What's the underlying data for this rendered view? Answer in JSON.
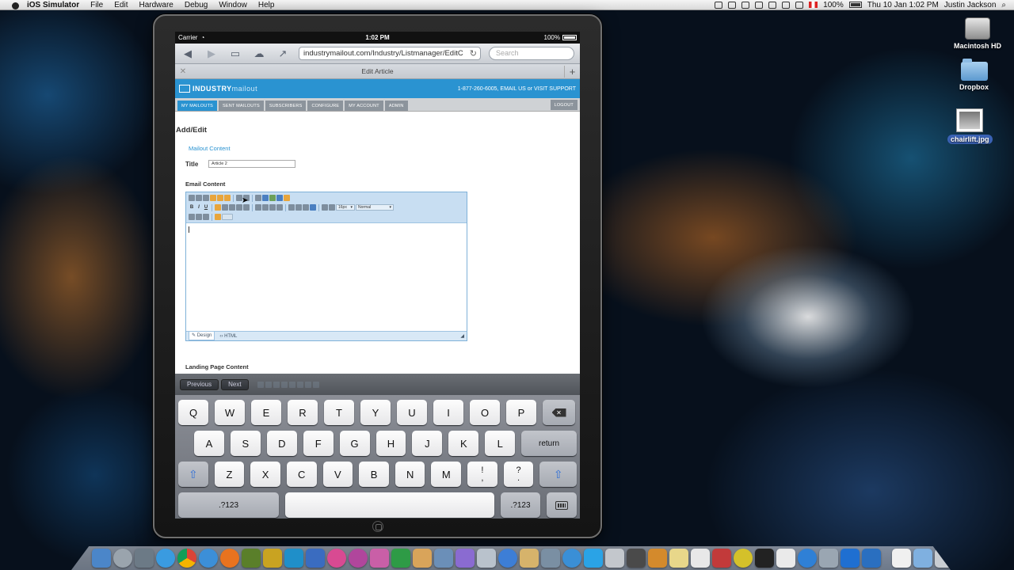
{
  "menubar": {
    "app_name": "iOS Simulator",
    "menus": [
      "File",
      "Edit",
      "Hardware",
      "Debug",
      "Window",
      "Help"
    ],
    "battery": "100%",
    "clock": "Thu 10 Jan  1:02 PM",
    "user": "Justin Jackson"
  },
  "desktop": {
    "icons": [
      {
        "label": "Macintosh HD"
      },
      {
        "label": "Dropbox"
      },
      {
        "label": "chairlift.jpg"
      }
    ]
  },
  "ios_status": {
    "carrier": "Carrier",
    "time": "1:02 PM",
    "battery": "100%"
  },
  "safari": {
    "url": "industrymailout.com/Industry/Listmanager/EditC",
    "search_placeholder": "Search",
    "tab_title": "Edit Article"
  },
  "site": {
    "logo_bold": "INDUSTRY",
    "logo_thin": "mailout",
    "contact": "1-877-260-6005, EMAIL US or VISIT SUPPORT",
    "nav": [
      "MY MAILOUTS",
      "SENT MAILOUTS",
      "SUBSCRIBERS",
      "CONFIGURE",
      "MY ACCOUNT",
      "ADMIN"
    ],
    "logout": "LOGOUT",
    "heading": "Add/Edit",
    "section": "Mailout Content",
    "title_label": "Title",
    "title_value": "Article 2",
    "email_content_label": "Email Content",
    "landing_label": "Landing Page Content",
    "editor": {
      "bold": "B",
      "italic": "I",
      "underline": "U",
      "font_size": "16px",
      "format": "Normal",
      "design_tab": "Design",
      "html_tab": "HTML"
    }
  },
  "accessory": {
    "previous": "Previous",
    "next": "Next"
  },
  "keyboard": {
    "row1": [
      "Q",
      "W",
      "E",
      "R",
      "T",
      "Y",
      "U",
      "I",
      "O",
      "P"
    ],
    "row2": [
      "A",
      "S",
      "D",
      "F",
      "G",
      "H",
      "J",
      "K",
      "L"
    ],
    "row3": [
      "Z",
      "X",
      "C",
      "V",
      "B",
      "N",
      "M"
    ],
    "punct1_top": "!",
    "punct1_bottom": ",",
    "punct2_top": "?",
    "punct2_bottom": ".",
    "return": "return",
    "numbers": ".?123"
  },
  "colors": {
    "site_blue": "#2a93d1",
    "nav_gray": "#8c949c"
  }
}
